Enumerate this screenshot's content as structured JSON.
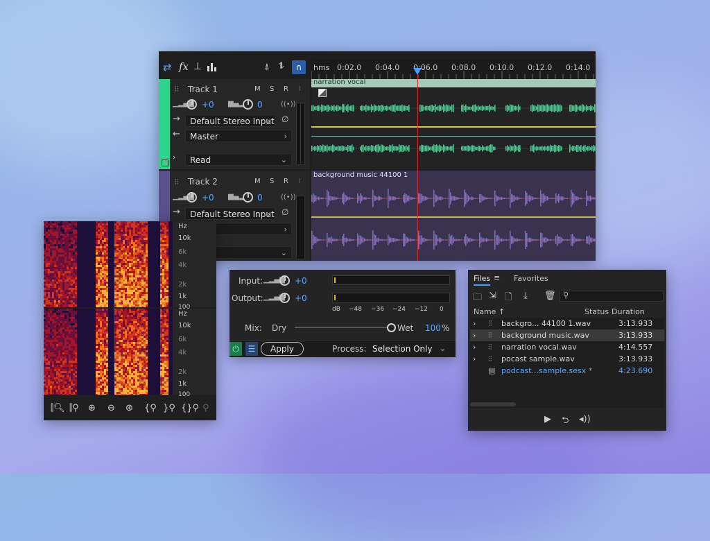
{
  "multitrack": {
    "ruler": {
      "unit": "hms",
      "ticks": [
        "0:02.0",
        "0:04.0",
        "0:06.0",
        "0:08.0",
        "0:10.0",
        "0:12.0",
        "0:14.0"
      ]
    },
    "tracks": [
      {
        "name": "Track 1",
        "volume": "+0",
        "pan": "0",
        "input": "Default Stereo Input",
        "output": "Master",
        "automation": "Read",
        "clip": "narration vocal"
      },
      {
        "name": "Track 2",
        "volume": "+0",
        "pan": "0",
        "input": "Default Stereo Input",
        "clip": "background music 44100 1"
      }
    ],
    "msr": [
      "M",
      "S",
      "R"
    ],
    "toolbar_icons": [
      "swap-icon",
      "fx-icon",
      "sends-icon",
      "eq-icon"
    ],
    "colors": {
      "track1": "#2fd48c",
      "track2": "#6d5ba8",
      "playhead": "#e02a2a",
      "accent": "#5aa9ff"
    }
  },
  "spectral": {
    "hz_labels_top": [
      "Hz",
      "10k",
      "6k",
      "4k",
      "2k",
      "1k",
      "100"
    ],
    "hz_labels_bottom": [
      "Hz",
      "10k",
      "6k",
      "4k",
      "2k",
      "1k",
      "100"
    ]
  },
  "effect": {
    "input_label": "Input:",
    "input_value": "+0",
    "output_label": "Output:",
    "output_value": "+0",
    "meter_scale": [
      "dB",
      "−48",
      "−36",
      "−24",
      "−12",
      "0"
    ],
    "mix_label": "Mix:",
    "dry_label": "Dry",
    "wet_label": "Wet",
    "mix_value": "100",
    "mix_unit": "%",
    "apply_label": "Apply",
    "process_label": "Process:",
    "process_value": "Selection Only"
  },
  "files": {
    "tabs": [
      "Files",
      "Favorites"
    ],
    "columns": {
      "name": "Name ↑",
      "status": "Status",
      "duration": "Duration"
    },
    "rows": [
      {
        "name": "backgro... 44100 1.wav",
        "duration": "3:13.933"
      },
      {
        "name": "background music.wav",
        "duration": "3:13.933"
      },
      {
        "name": "narration vocal.wav",
        "duration": "4:14.557"
      },
      {
        "name": "pocast sample.wav",
        "duration": "3:13.933"
      },
      {
        "name": "podcast...sample.sesx *",
        "duration": "4:23.690"
      }
    ]
  }
}
